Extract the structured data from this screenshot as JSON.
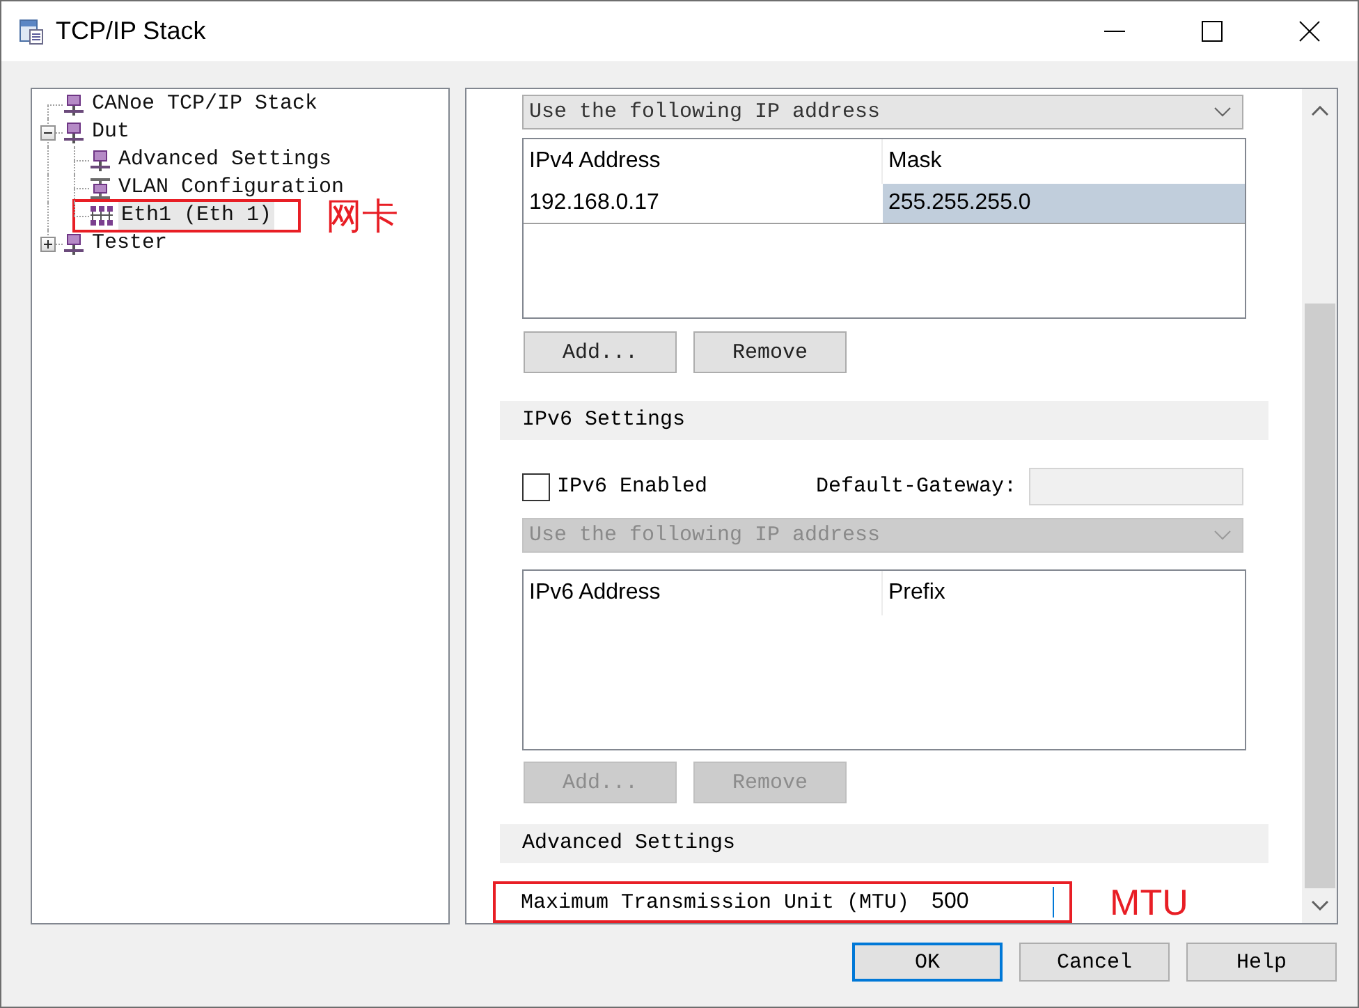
{
  "window": {
    "title": "TCP/IP Stack"
  },
  "tree": [
    {
      "label": "CANoe TCP/IP Stack",
      "kind": "node",
      "selected": false
    },
    {
      "label": "Dut",
      "kind": "node",
      "selected": false,
      "expanded": true,
      "children": [
        {
          "label": "Advanced Settings",
          "kind": "node",
          "selected": false
        },
        {
          "label": "VLAN Configuration",
          "kind": "vlan",
          "selected": false
        },
        {
          "label": "Eth1 (Eth 1)",
          "kind": "adapter",
          "selected": true,
          "annotation": {
            "text": "网卡"
          }
        }
      ]
    },
    {
      "label": "Tester",
      "kind": "node",
      "selected": false,
      "expanded": false
    }
  ],
  "ipv4": {
    "mode": {
      "text": "Use the following IP address",
      "disabled": false
    },
    "columns": [
      "IPv4 Address",
      "Mask"
    ],
    "rows": [
      {
        "cells": [
          {
            "text": "192.168.0.17",
            "selected": false
          },
          {
            "text": "255.255.255.0",
            "selected": true
          }
        ]
      }
    ],
    "buttons": [
      {
        "label": "Add...",
        "disabled": false
      },
      {
        "label": "Remove",
        "disabled": false
      }
    ]
  },
  "ipv6": {
    "title": "IPv6 Settings",
    "enabled": {
      "label": "IPv6 Enabled",
      "checked": false
    },
    "gateway": {
      "label": "Default-Gateway:",
      "disabled": true
    },
    "mode": {
      "text": "Use the following IP address",
      "disabled": true
    },
    "columns": [
      "IPv6 Address",
      "Prefix"
    ],
    "buttons": [
      {
        "label": "Add...",
        "disabled": true
      },
      {
        "label": "Remove",
        "disabled": true
      }
    ]
  },
  "advanced": {
    "title": "Advanced Settings",
    "mtu": {
      "label": "Maximum Transmission Unit (MTU)",
      "value": "500",
      "focused": true,
      "annotation": {
        "text": "MTU"
      }
    }
  },
  "buttons": [
    {
      "label": "OK",
      "default": true
    },
    {
      "label": "Cancel",
      "default": false
    },
    {
      "label": "Help",
      "default": false
    }
  ]
}
